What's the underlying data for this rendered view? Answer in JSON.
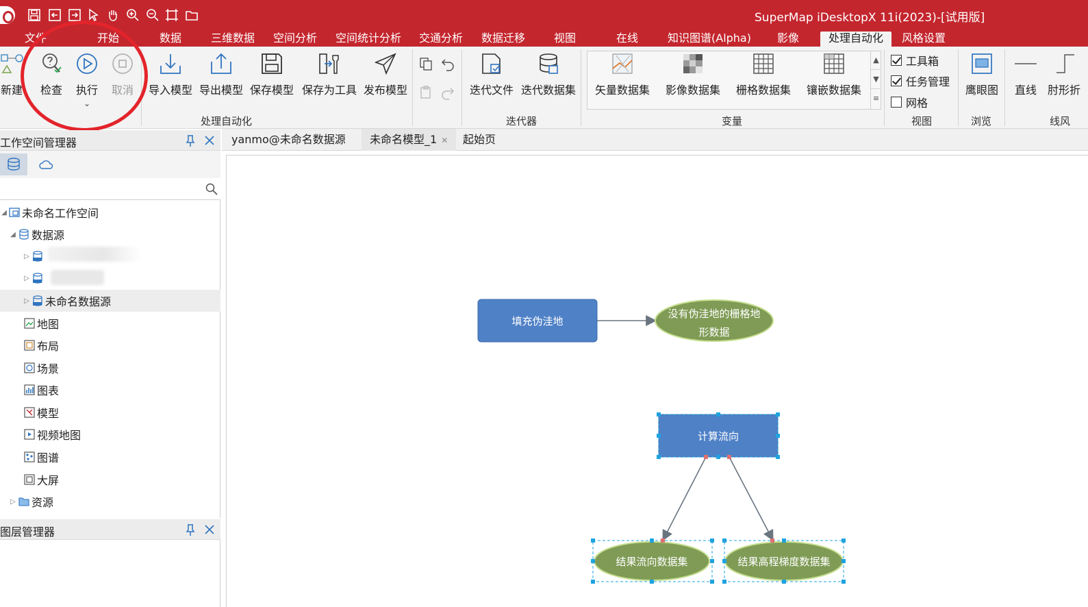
{
  "title_bar": {
    "window_title": "SuperMap iDesktopX 11i(2023)-[试用版]",
    "quick_access_icons": [
      "save-icon",
      "import-icon",
      "export-icon",
      "select-arrow-icon",
      "pan-hand-icon",
      "zoom-in-icon",
      "zoom-out-icon",
      "full-extent-icon",
      "open-folder-icon"
    ]
  },
  "ribbon_tabs": [
    "文件",
    "开始",
    "数据",
    "三维数据",
    "空间分析",
    "空间统计分析",
    "交通分析",
    "数据迁移",
    "视图",
    "在线",
    "知识图谱(Alpha)",
    "影像",
    "处理自动化",
    "风格设置"
  ],
  "active_tab": "处理自动化",
  "ribbon": {
    "new_label": "新建",
    "check_label": "检查",
    "run_label": "执行",
    "cancel_label": "取消",
    "import_model_label": "导入模型",
    "export_model_label": "导出模型",
    "save_model_label": "保存模型",
    "save_as_tool_label": "保存为工具",
    "publish_model_label": "发布模型",
    "group_automation": "处理自动化",
    "iterate_file_label": "迭代文件",
    "iterate_dataset_label": "迭代数据集",
    "group_iterator": "迭代器",
    "vector_dataset_label": "矢量数据集",
    "image_dataset_label": "影像数据集",
    "grid_dataset_label": "栅格数据集",
    "mosaic_dataset_label": "镶嵌数据集",
    "group_variable": "变量",
    "toolbox_label": "工具箱",
    "toolbox_checked": true,
    "task_manager_label": "任务管理",
    "task_manager_checked": true,
    "grid_label": "网格",
    "grid_checked": false,
    "group_view": "视图",
    "eagle_eye_label": "鹰眼图",
    "group_browse": "浏览",
    "straight_line_label": "直线",
    "elbow_line_label": "肘形折",
    "group_line_style": "线风"
  },
  "workspace_panel": {
    "title": "工作空间管理器",
    "search_placeholder": "",
    "tree": {
      "workspace": "未命名工作空间",
      "datasources": "数据源",
      "unnamed_datasource": "未命名数据源",
      "map": "地图",
      "layout": "布局",
      "scene": "场景",
      "chart": "图表",
      "model": "模型",
      "video_map": "视频地图",
      "graph": "图谱",
      "big_screen": "大屏",
      "resources": "资源"
    }
  },
  "layer_panel": {
    "title": "图层管理器"
  },
  "doc_tabs": [
    "yanmo@未命名数据源",
    "未命名模型_1",
    "起始页"
  ],
  "active_doc_tab": "未命名模型_1",
  "model": {
    "fill_depressions": "填充伪洼地",
    "no_depression_grid_line1": "没有伪洼地的栅格地",
    "no_depression_grid_line2": "形数据",
    "flow_direction": "计算流向",
    "flow_direction_result": "结果流向数据集",
    "elevation_gradient_result": "结果高程梯度数据集"
  },
  "colors": {
    "title_bar": "#c4262e",
    "process_node": "#4f81c7",
    "data_node": "#7f9b55",
    "annotation_circle": "#e3242b",
    "selection_handle": "#1fa3e0"
  }
}
